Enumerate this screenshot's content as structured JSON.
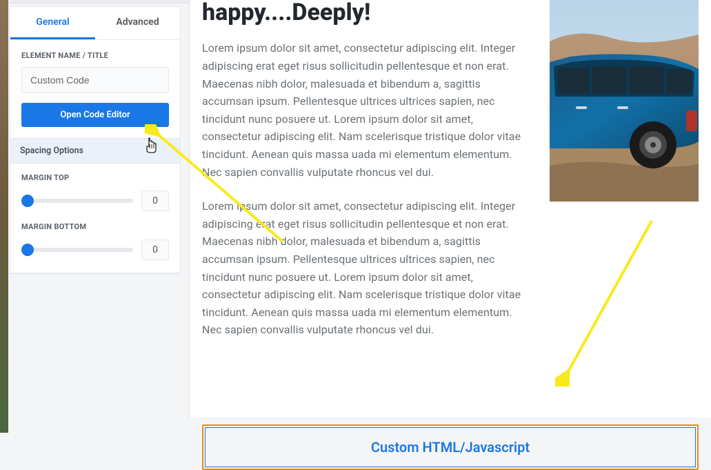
{
  "sidebar": {
    "tabs": {
      "general": "General",
      "advanced": "Advanced"
    },
    "element_name_label": "ELEMENT NAME / TITLE",
    "element_name_value": "Custom Code",
    "open_editor_label": "Open Code Editor",
    "spacing_header": "Spacing Options",
    "margin_top_label": "MARGIN TOP",
    "margin_top_value": "0",
    "margin_bottom_label": "MARGIN BOTTOM",
    "margin_bottom_value": "0"
  },
  "main": {
    "title": "happy....Deeply!",
    "para1": "Lorem ipsum dolor sit amet, consectetur adipiscing elit. Integer adipiscing erat eget risus sollicitudin pellentesque et non erat. Maecenas nibh dolor, malesuada et bibendum a, sagittis accumsan ipsum. Pellentesque ultrices ultrices sapien, nec tincidunt nunc posuere ut. Lorem ipsum dolor sit amet, consectetur adipiscing elit. Nam scelerisque tristique dolor vitae tincidunt. Aenean quis massa uada mi elementum elementum. Nec sapien convallis vulputate rhoncus vel dui.",
    "para2": "Lorem ipsum dolor sit amet, consectetur adipiscing elit. Integer adipiscing erat eget risus sollicitudin pellentesque et non erat. Maecenas nibh dolor, malesuada et bibendum a, sagittis accumsan ipsum. Pellentesque ultrices ultrices sapien, nec tincidunt nunc posuere ut. Lorem ipsum dolor sit amet, consectetur adipiscing elit. Nam scelerisque tristique dolor vitae tincidunt. Aenean quis massa uada mi elementum elementum. Nec sapien convallis vulputate rhoncus vel dui.",
    "custom_box_label": "Custom HTML/Javascript"
  }
}
